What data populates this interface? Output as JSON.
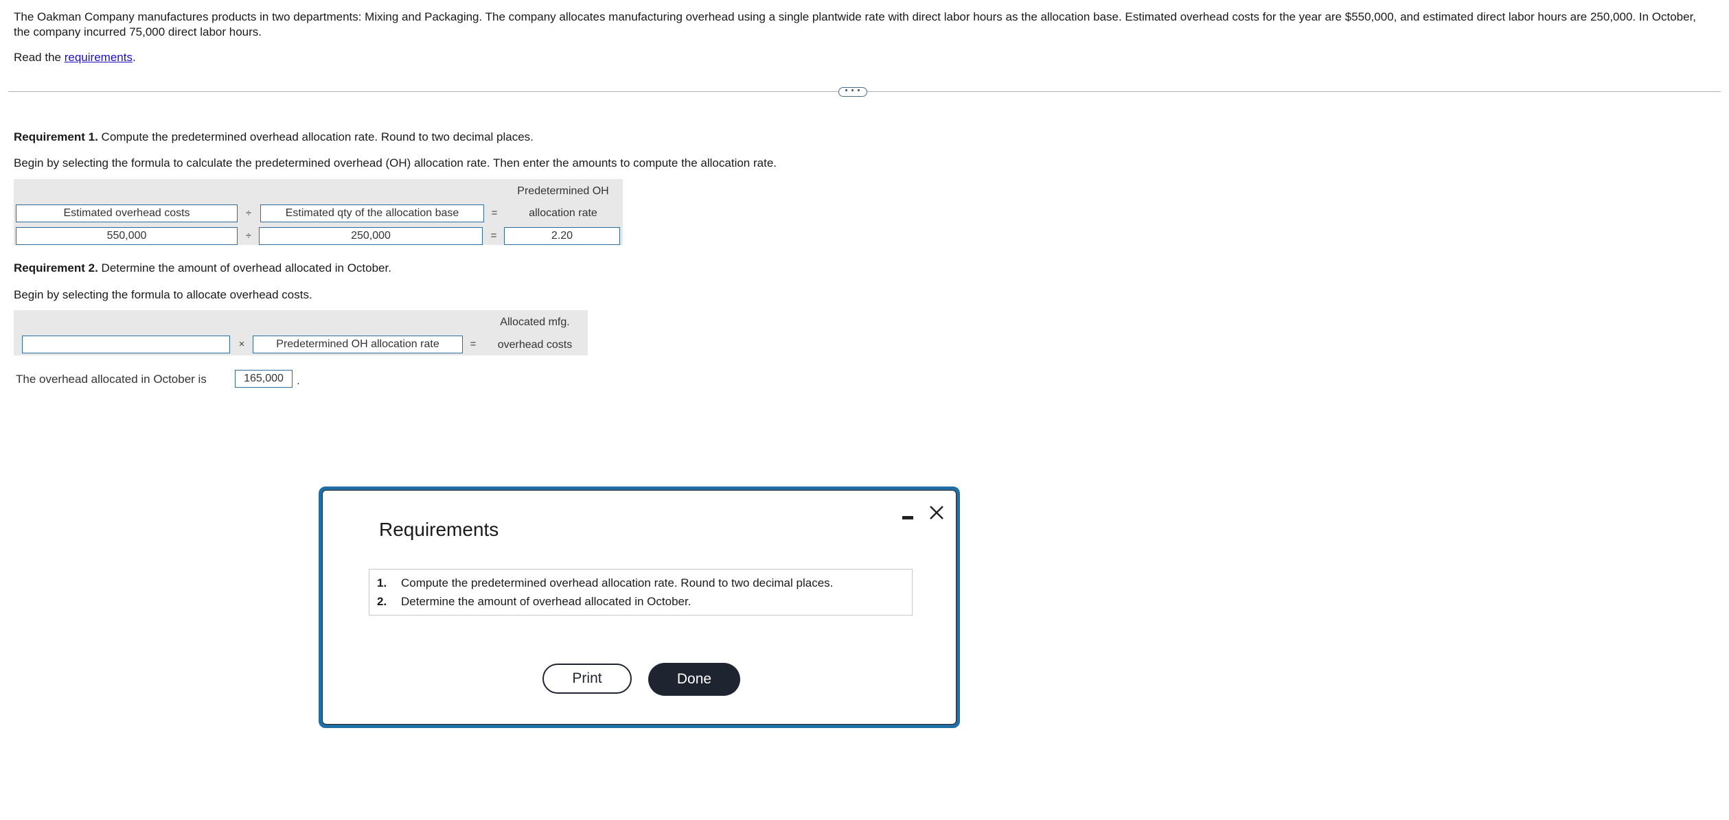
{
  "problem": {
    "intro": "The Oakman Company manufactures products in two departments: Mixing and Packaging. The company allocates manufacturing overhead using a single plantwide rate with direct labor hours as the allocation base. Estimated overhead costs for the year are $550,000, and estimated direct labor hours are 250,000. In October, the company incurred 75,000 direct labor hours.",
    "read_prefix": "Read the ",
    "read_link": "requirements",
    "read_suffix": ".",
    "more_label": "• • •"
  },
  "req1": {
    "title": "Requirement 1.",
    "text": " Compute the predetermined overhead allocation rate. Round to two decimal places.",
    "instruction": "Begin by selecting the formula to calculate the predetermined overhead (OH) allocation rate. Then enter the amounts to compute the allocation rate.",
    "result_header_line1": "Predetermined OH",
    "result_header_line2": "allocation rate",
    "formula": {
      "term1": "Estimated overhead costs",
      "op1": "÷",
      "term2": "Estimated qty of the allocation base",
      "eq": "="
    },
    "values": {
      "val1": "550,000",
      "op1": "÷",
      "val2": "250,000",
      "eq": "=",
      "result": "2.20"
    }
  },
  "req2": {
    "title": "Requirement 2.",
    "text": " Determine the amount of overhead allocated in October.",
    "instruction": "Begin by selecting the formula to allocate overhead costs.",
    "result_header_line1": "Allocated mfg.",
    "result_header_line2": "overhead costs",
    "formula": {
      "term1": "",
      "op1": "×",
      "term2": "Predetermined OH allocation rate",
      "eq": "="
    },
    "answer_label": "The overhead allocated in October is",
    "answer_value": "165,000",
    "answer_suffix": "."
  },
  "modal": {
    "title": "Requirements",
    "items": [
      {
        "num": "1.",
        "text": "Compute the predetermined overhead allocation rate. Round to two decimal places."
      },
      {
        "num": "2.",
        "text": "Determine the amount of overhead allocated in October."
      }
    ],
    "print_label": "Print",
    "done_label": "Done",
    "close_icon": "close-icon",
    "minimize_icon": "minimize-icon"
  }
}
